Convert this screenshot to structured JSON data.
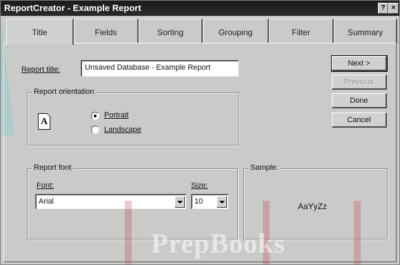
{
  "window": {
    "title": "ReportCreator - Example Report",
    "help_glyph": "?",
    "close_glyph": "×"
  },
  "tabs": [
    {
      "label": "Title"
    },
    {
      "label": "Fields"
    },
    {
      "label": "Sorting"
    },
    {
      "label": "Grouping"
    },
    {
      "label": "Filter"
    },
    {
      "label": "Summary"
    }
  ],
  "title_section": {
    "label": "Report title:",
    "value": "Unsaved Database  - Example Report"
  },
  "orientation": {
    "legend": "Report orientation",
    "icon_letter": "A",
    "options": [
      {
        "label": "Portrait",
        "selected": true
      },
      {
        "label": "Landscape",
        "selected": false
      }
    ]
  },
  "font_section": {
    "legend": "Report font",
    "font_label": "Font:",
    "font_value": "Arial",
    "size_label": "Size:",
    "size_value": "10"
  },
  "sample": {
    "legend": "Sample:",
    "text": "AaYyZz"
  },
  "buttons": {
    "next": "Next >",
    "previous": "Previous",
    "done": "Done",
    "cancel": "Cancel"
  },
  "watermark": {
    "text": "PrepBooks"
  },
  "colors": {
    "titlebar": "#1b1b1b",
    "dialog": "#c8cbc8",
    "watermark_cyan": "#3cc8d2",
    "watermark_red": "#c83c50"
  }
}
